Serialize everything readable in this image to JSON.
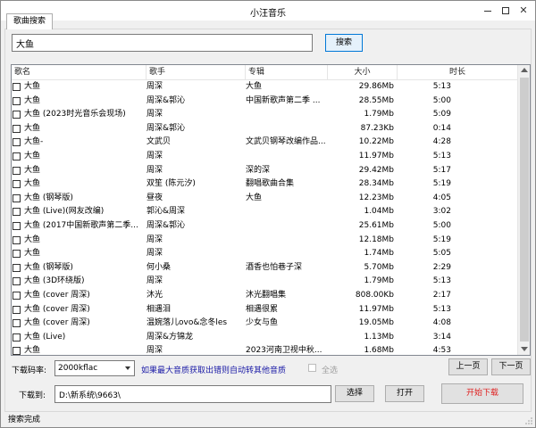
{
  "window": {
    "title": "小汪音乐"
  },
  "tabs": [
    {
      "label": "歌曲搜索"
    }
  ],
  "search": {
    "value": "大鱼",
    "button_label": "搜索"
  },
  "table": {
    "columns": [
      "歌名",
      "歌手",
      "专辑",
      "大小",
      "时长"
    ],
    "rows": [
      {
        "name": "大鱼",
        "singer": "周深",
        "album": "大鱼",
        "size": "29.86Mb",
        "time": "5:13"
      },
      {
        "name": "大鱼",
        "singer": "周深&郭沁",
        "album": "中国新歌声第二季 ...",
        "size": "28.55Mb",
        "time": "5:00"
      },
      {
        "name": "大鱼 (2023时光音乐会现场)",
        "singer": "周深",
        "album": "",
        "size": "1.79Mb",
        "time": "5:09"
      },
      {
        "name": "大鱼",
        "singer": "周深&郭沁",
        "album": "",
        "size": "87.23Kb",
        "time": "0:14"
      },
      {
        "name": "大鱼-",
        "singer": "文武贝",
        "album": "文武贝钢琴改编作品...",
        "size": "10.22Mb",
        "time": "4:28"
      },
      {
        "name": "大鱼",
        "singer": "周深",
        "album": "",
        "size": "11.97Mb",
        "time": "5:13"
      },
      {
        "name": "大鱼",
        "singer": "周深",
        "album": "深的深",
        "size": "29.42Mb",
        "time": "5:17"
      },
      {
        "name": "大鱼",
        "singer": "双笙 (陈元汐)",
        "album": "翻唱歌曲合集",
        "size": "28.34Mb",
        "time": "5:19"
      },
      {
        "name": "大鱼 (钢琴版)",
        "singer": "昼夜",
        "album": "大鱼",
        "size": "12.23Mb",
        "time": "4:05"
      },
      {
        "name": "大鱼 (Live)(网友改编)",
        "singer": "郭沁&周深",
        "album": "",
        "size": "1.04Mb",
        "time": "3:02"
      },
      {
        "name": "大鱼 (2017中国新歌声第二季...",
        "singer": "周深&郭沁",
        "album": "",
        "size": "25.61Mb",
        "time": "5:00"
      },
      {
        "name": "大鱼",
        "singer": "周深",
        "album": "",
        "size": "12.18Mb",
        "time": "5:19"
      },
      {
        "name": "大鱼",
        "singer": "周深",
        "album": "",
        "size": "1.74Mb",
        "time": "5:05"
      },
      {
        "name": "大鱼 (钢琴版)",
        "singer": "何小桑",
        "album": "酒香也怕巷子深",
        "size": "5.70Mb",
        "time": "2:29"
      },
      {
        "name": "大鱼 (3D环绕版)",
        "singer": "周深",
        "album": "",
        "size": "1.79Mb",
        "time": "5:13"
      },
      {
        "name": "大鱼 (cover 周深)",
        "singer": "沐光",
        "album": "沐光翻唱集",
        "size": "808.00Kb",
        "time": "2:17"
      },
      {
        "name": "大鱼 (cover 周深)",
        "singer": "相遇泪",
        "album": "相遇很累",
        "size": "11.97Mb",
        "time": "5:13"
      },
      {
        "name": "大鱼 (cover 周深)",
        "singer": "温婉落儿ovo&念冬les",
        "album": "少女与鱼",
        "size": "19.05Mb",
        "time": "4:08"
      },
      {
        "name": "大鱼 (Live)",
        "singer": "周深&方锦龙",
        "album": "",
        "size": "1.13Mb",
        "time": "3:14"
      },
      {
        "name": "大鱼",
        "singer": "周深",
        "album": "2023河南卫视中秋...",
        "size": "1.68Mb",
        "time": "4:53"
      }
    ]
  },
  "download": {
    "rate_label": "下载码率:",
    "rate_value": "2000kflac",
    "hint": "如果最大音质获取出错则自动转其他音质",
    "select_all_label": "全选",
    "prev_label": "上一页",
    "next_label": "下一页",
    "path_label": "下载到:",
    "path_value": "D:\\新系统\\9663\\",
    "choose_label": "选择",
    "open_label": "打开",
    "start_label": "开始下载"
  },
  "status": {
    "text": "搜索完成"
  },
  "colors": {
    "accent": "#0078d7",
    "start_text": "#e02020",
    "hint_text": "#1a1aa6"
  }
}
